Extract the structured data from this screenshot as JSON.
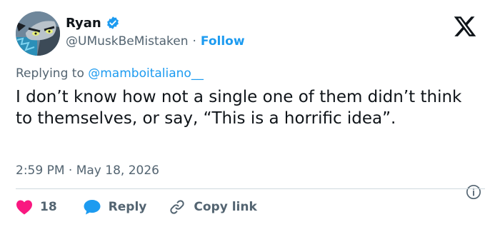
{
  "author": {
    "name": "Ryan",
    "handle": "@UMuskBeMistaken",
    "separator": "·",
    "follow_label": "Follow",
    "verified_icon": "verified-badge-icon"
  },
  "reply_context": {
    "label": "Replying to",
    "mention": "@mamboitaliano__"
  },
  "tweet": {
    "text": "I don’t know how not a single one of them didn’t think to themselves, or say, “This is a horrific idea”.",
    "timestamp": "2:59 PM · May 18, 2026"
  },
  "actions": {
    "like_count": "18",
    "reply_label": "Reply",
    "copy_link_label": "Copy link"
  },
  "colors": {
    "accent": "#1d9bf0",
    "like": "#f91880",
    "muted": "#536471",
    "text": "#0f1419"
  }
}
